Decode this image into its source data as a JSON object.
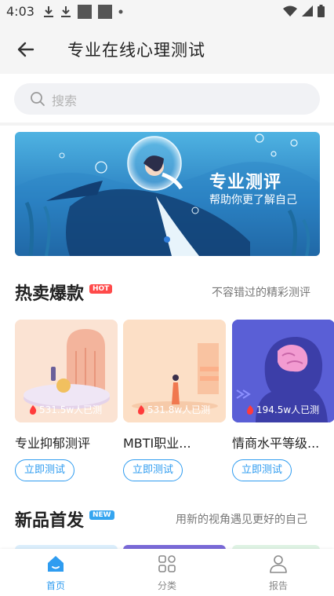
{
  "status_bar": {
    "time": "4:03"
  },
  "header": {
    "title": "专业在线心理测试"
  },
  "search": {
    "placeholder": "搜索"
  },
  "banner": {
    "title": "专业测评",
    "subtitle": "帮助你更了解自己"
  },
  "hot_section": {
    "title": "热卖爆款",
    "badge": "HOT",
    "subtitle": "不容错过的精彩测评",
    "cards": [
      {
        "title": "专业抑郁测评",
        "count": "531.5w人已测",
        "button": "立即测试"
      },
      {
        "title": "MBTI职业...",
        "count": "531.8w人已测",
        "button": "立即测试"
      },
      {
        "title": "情商水平等级...",
        "count": "194.5w人已测",
        "button": "立即测试"
      }
    ]
  },
  "new_section": {
    "title": "新品首发",
    "badge": "NEW",
    "subtitle": "用新的视角遇见更好的自己"
  },
  "tabbar": {
    "tabs": [
      {
        "label": "首页",
        "active": true
      },
      {
        "label": "分类",
        "active": false
      },
      {
        "label": "报告",
        "active": false
      }
    ]
  },
  "colors": {
    "accent": "#2f9cf0",
    "hot": "#ff4a4a",
    "new": "#35a5f0"
  }
}
